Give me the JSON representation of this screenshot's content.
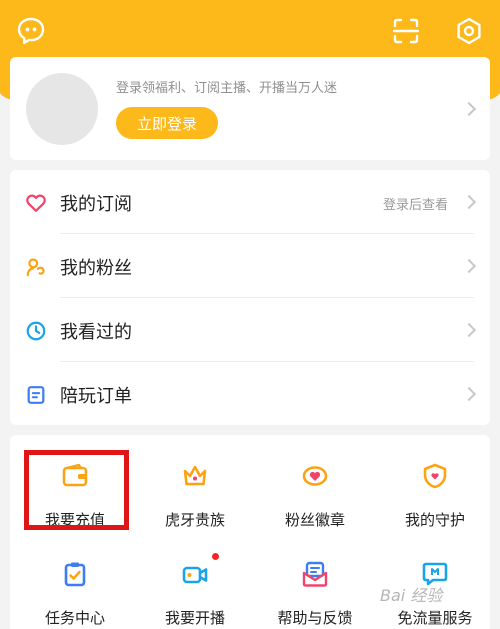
{
  "header": {
    "message_icon": "chat-bubble-icon",
    "scan_icon": "scan-icon",
    "settings_icon": "hexagon-settings-icon"
  },
  "login": {
    "tip": "登录领福利、订阅主播、开播当万人迷",
    "button": "立即登录"
  },
  "menu": [
    {
      "label": "我的订阅",
      "hint": "登录后查看",
      "icon": "heart-icon",
      "color": "#f2436b"
    },
    {
      "label": "我的粉丝",
      "hint": "",
      "icon": "fans-icon",
      "color": "#fca315"
    },
    {
      "label": "我看过的",
      "hint": "",
      "icon": "clock-icon",
      "color": "#1aa3e8"
    },
    {
      "label": "陪玩订单",
      "hint": "",
      "icon": "order-icon",
      "color": "#3d7cf2"
    }
  ],
  "grid": [
    {
      "label": "我要充值",
      "icon": "wallet-icon"
    },
    {
      "label": "虎牙贵族",
      "icon": "crown-icon"
    },
    {
      "label": "粉丝徽章",
      "icon": "fan-badge-icon"
    },
    {
      "label": "我的守护",
      "icon": "shield-icon"
    },
    {
      "label": "任务中心",
      "icon": "task-clipboard-icon"
    },
    {
      "label": "我要开播",
      "icon": "video-camera-icon"
    },
    {
      "label": "帮助与反馈",
      "icon": "help-feedback-icon"
    },
    {
      "label": "免流量服务",
      "icon": "free-data-icon"
    }
  ],
  "watermark": "Bai 经验",
  "colors": {
    "brand": "#fdb81a",
    "highlight": "#e01515",
    "badge_dot": "#ff2222"
  }
}
